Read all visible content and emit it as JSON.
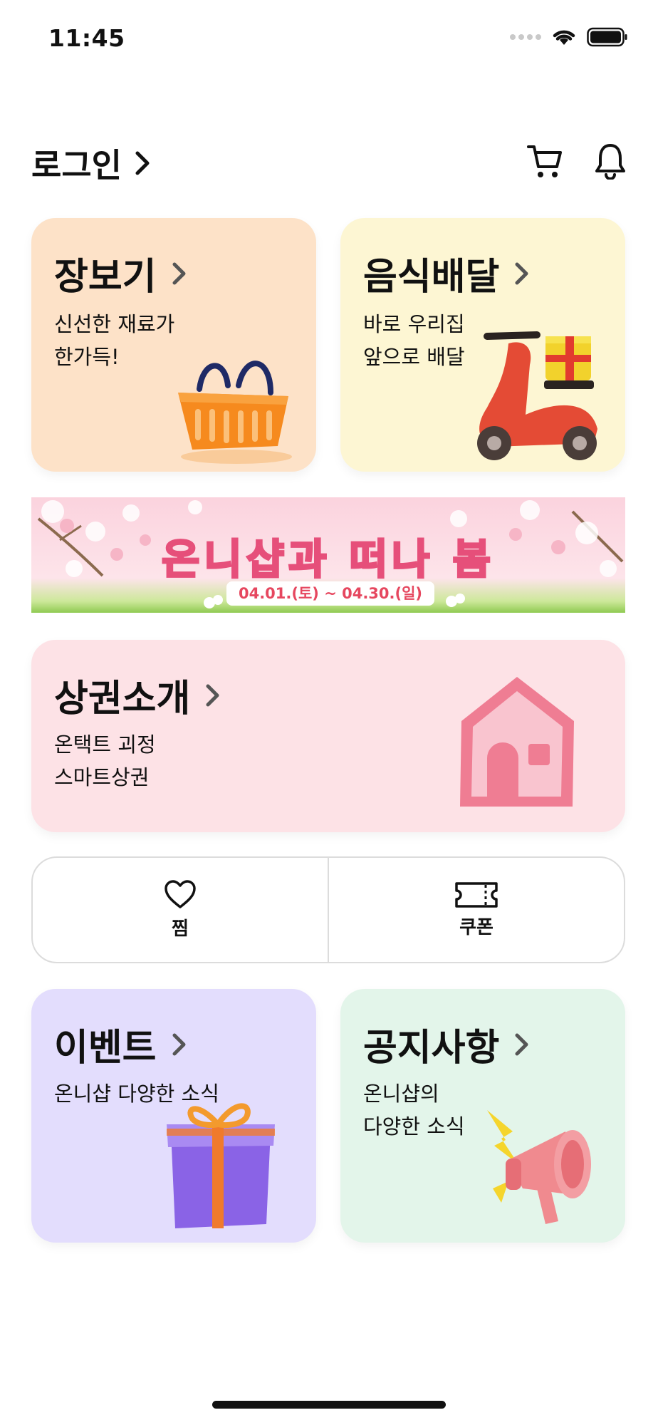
{
  "status_bar": {
    "time": "11:45"
  },
  "header": {
    "login_label": "로그인"
  },
  "cards": {
    "grocery": {
      "title": "장보기",
      "desc": [
        "신선한 재료가",
        "한가득!"
      ],
      "bg": "#fde2c8"
    },
    "food_delivery": {
      "title": "음식배달",
      "desc": [
        "바로 우리집",
        "앞으로 배달"
      ],
      "bg": "#fdf6d3"
    },
    "district": {
      "title": "상권소개",
      "desc": [
        "온택트 괴정",
        "스마트상권"
      ],
      "bg": "#fde2e6"
    },
    "event": {
      "title": "이벤트",
      "desc": [
        "온니샵 다양한 소식"
      ],
      "bg": "#e3ddfd"
    },
    "notice": {
      "title": "공지사항",
      "desc": [
        "온니샵의",
        "다양한 소식"
      ],
      "bg": "#e3f5ea"
    }
  },
  "banner": {
    "title": "온니샵과 떠나 봄",
    "date": "04.01.(토) ~ 04.30.(일)"
  },
  "quick": {
    "wishlist_label": "찜",
    "coupon_label": "쿠폰"
  }
}
